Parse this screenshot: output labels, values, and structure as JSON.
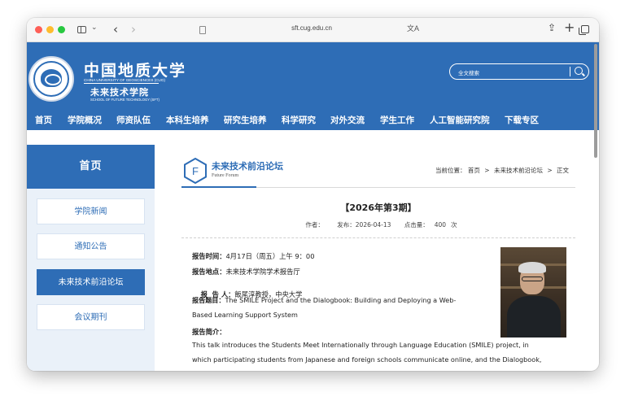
{
  "browser": {
    "url": "sft.cug.edu.cn"
  },
  "site": {
    "logo_cn": "中国地质大学",
    "logo_en": "CHINA UNIVERSITY OF GEOSCIENCES (CUG)",
    "school_name": "未来技术学院",
    "school_en": "SCHOOL OF FUTURE TECHNOLOGY (SFT)",
    "search_placeholder": "全文搜索",
    "nav": [
      "首页",
      "学院概况",
      "师资队伍",
      "本科生培养",
      "研究生培养",
      "科学研究",
      "对外交流",
      "学生工作",
      "人工智能研究院",
      "下载专区"
    ]
  },
  "sidebar": {
    "home": "首页",
    "items": [
      {
        "label": "学院新闻"
      },
      {
        "label": "通知公告"
      },
      {
        "label": "未来技术前沿论坛",
        "active": true
      },
      {
        "label": "会议期刊"
      }
    ]
  },
  "column": {
    "logo_letter": "F",
    "title": "未来技术前沿论坛",
    "title_en": "Future Forum"
  },
  "breadcrumb": {
    "prefix": "当前位置：",
    "items": [
      "首页",
      "未来技术前沿论坛",
      "正文"
    ],
    "separator": ">"
  },
  "article": {
    "title": "【2026年第3期】",
    "author_label": "作者：",
    "date_label": "发布：2026-04-13",
    "hits_label": "点击量：",
    "hits_value": "400",
    "hits_unit": "次",
    "time_label": "报告时间：",
    "time_value": "4月17日（周五）上午 9：00",
    "place_label": "报告地点：",
    "place_value": "未来技术学院学术报告厅",
    "speaker_label": "报  告 人：",
    "speaker_value": "飯尾淳教授，中央大学",
    "topic_label": "报告题目：",
    "topic_value_line1": "The SMILE Project and the Dialogbook: Building and Deploying a Web-",
    "topic_value_line2": "Based Learning Support System",
    "abstract_label": "报告简介：",
    "abstract_line1": "This talk introduces the Students Meet Internationally through Language Education (SMILE) project, in",
    "abstract_line2": "which participating students from Japanese and foreign schools communicate online, and the Dialogbook,"
  }
}
